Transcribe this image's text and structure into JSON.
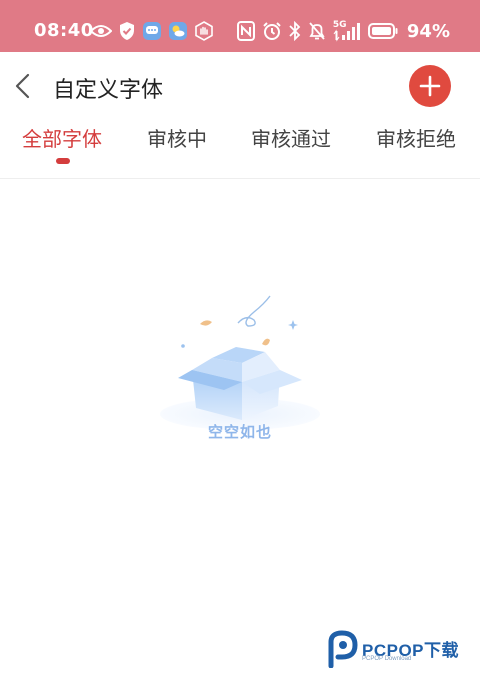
{
  "status_bar": {
    "time": "08:40",
    "network": "5G",
    "battery_percent": "94%",
    "left_icons": [
      "eye-icon",
      "shield-check-icon",
      "message-icon",
      "weather-icon",
      "hand-icon"
    ],
    "right_icons": [
      "nfc-icon",
      "alarm-icon",
      "bluetooth-icon",
      "mute-icon",
      "signal-icon",
      "battery-icon"
    ],
    "background_color": "#e07a86"
  },
  "header": {
    "title": "自定义字体",
    "back_icon": "chevron-left-icon",
    "add_icon": "plus-icon",
    "accent_color": "#e04a3f"
  },
  "tabs": [
    {
      "label": "全部字体",
      "active": true
    },
    {
      "label": "审核中",
      "active": false
    },
    {
      "label": "审核通过",
      "active": false
    },
    {
      "label": "审核拒绝",
      "active": false
    }
  ],
  "empty_state": {
    "text": "空空如也",
    "icon": "empty-box-icon"
  },
  "watermark": {
    "brand": "PCPOP下载",
    "subtitle": "PCPOP Download"
  }
}
